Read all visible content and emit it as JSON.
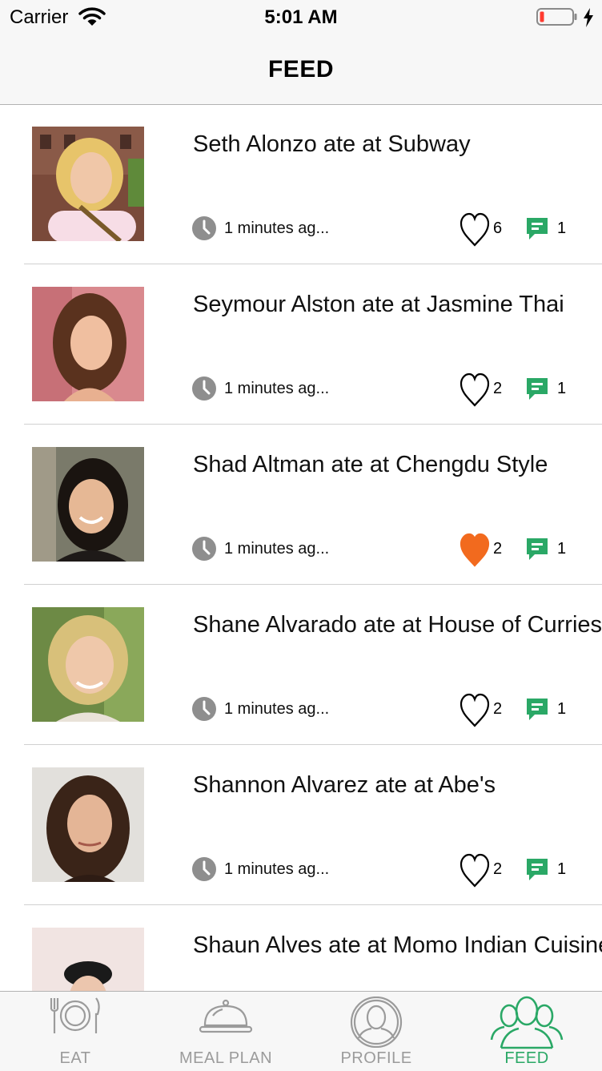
{
  "status_bar": {
    "carrier": "Carrier",
    "time": "5:01 AM"
  },
  "nav": {
    "title": "FEED"
  },
  "colors": {
    "accent_green": "#2aa866",
    "like_orange": "#f26a1e",
    "icon_gray": "#8e8e8e"
  },
  "feed": [
    {
      "title": "Seth Alonzo ate at Subway",
      "time": "1 minutes ag...",
      "likes": "6",
      "comments": "1",
      "liked": false
    },
    {
      "title": "Seymour Alston ate at Jasmine Thai",
      "time": "1 minutes ag...",
      "likes": "2",
      "comments": "1",
      "liked": false
    },
    {
      "title": "Shad Altman ate at Chengdu Style",
      "time": "1 minutes ag...",
      "likes": "2",
      "comments": "1",
      "liked": true
    },
    {
      "title": "Shane Alvarado ate at House of Curries",
      "time": "1 minutes ag...",
      "likes": "2",
      "comments": "1",
      "liked": false
    },
    {
      "title": "Shannon Alvarez ate at Abe's",
      "time": "1 minutes ag...",
      "likes": "2",
      "comments": "1",
      "liked": false
    },
    {
      "title": "Shaun Alves ate at Momo Indian Cuisine",
      "time": "",
      "likes": "",
      "comments": "",
      "liked": false
    }
  ],
  "tabs": [
    {
      "label": "EAT",
      "icon": "plate-cutlery-icon",
      "active": false
    },
    {
      "label": "MEAL PLAN",
      "icon": "cloche-icon",
      "active": false
    },
    {
      "label": "PROFILE",
      "icon": "profile-icon",
      "active": false
    },
    {
      "label": "FEED",
      "icon": "group-icon",
      "active": true
    }
  ]
}
